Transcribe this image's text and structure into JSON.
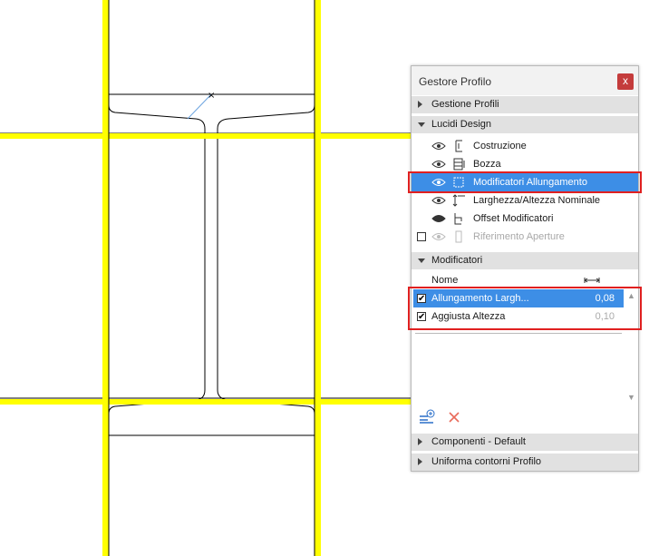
{
  "panel": {
    "title": "Gestore Profilo",
    "close_glyph": "x",
    "sections": {
      "gestione_profili": "Gestione Profili",
      "lucidi_design": "Lucidi Design",
      "modificatori": "Modificatori",
      "componenti": "Componenti - Default",
      "uniforma": "Uniforma contorni Profilo"
    },
    "layers": [
      {
        "label": "Costruzione",
        "icon": "construction-icon",
        "visible": true
      },
      {
        "label": "Bozza",
        "icon": "draft-icon",
        "visible": true
      },
      {
        "label": "Modificatori Allungamento",
        "icon": "stretch-modifiers-icon",
        "visible": true,
        "selected": true
      },
      {
        "label": "Larghezza/Altezza Nominale",
        "icon": "nominal-size-icon",
        "visible": true
      },
      {
        "label": "Offset Modificatori",
        "icon": "offset-modifiers-icon",
        "visible": true
      },
      {
        "label": "Riferimento Aperture",
        "icon": "opening-reference-icon",
        "visible": false
      }
    ],
    "table": {
      "col_name": "Nome",
      "col_value_icon": "width-arrows-icon",
      "rows": [
        {
          "checked": true,
          "name": "Allungamento Largh...",
          "value": "0,08",
          "selected": true
        },
        {
          "checked": true,
          "name": "Aggiusta Altezza",
          "value": "0,10",
          "selected": false
        }
      ]
    },
    "tools": {
      "add_icon": "add-modifier-icon",
      "delete_icon": "delete-icon"
    }
  },
  "colors": {
    "guide_yellow": "#ffff00",
    "highlight_blue": "#3d8ee6",
    "annotation_red": "#e02020",
    "section_gray": "#e1e1e1"
  }
}
